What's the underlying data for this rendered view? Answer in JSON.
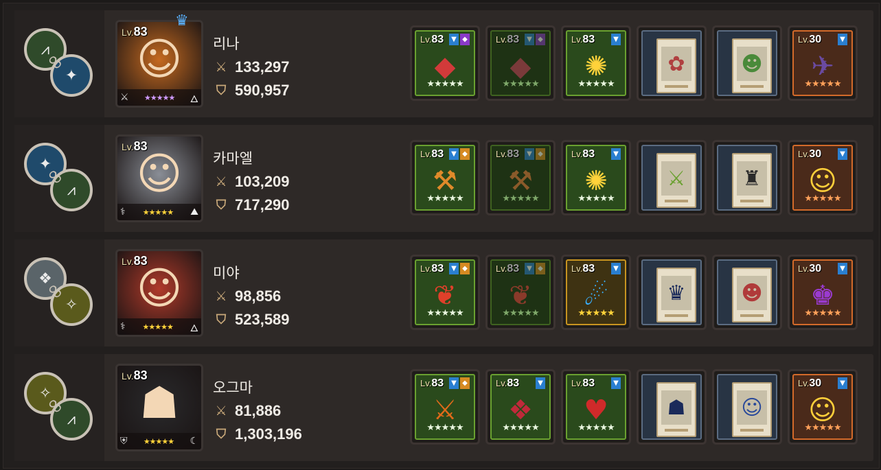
{
  "colors": {
    "star_white": "#eaf7e0",
    "star_gold": "#ffd33a",
    "star_purple": "#d09bff",
    "star_orange": "#ffa15a",
    "star_dim": "#7fa86a"
  },
  "rows": [
    {
      "emblems": [
        {
          "icon": "claw-icon",
          "glyph": "⩘",
          "color": "green"
        },
        {
          "icon": "wings-icon",
          "glyph": "✦",
          "color": "blue"
        }
      ],
      "hero": {
        "lv_prefix": "Lv.",
        "lv": "83",
        "name": "리나",
        "atk": "133,297",
        "def": "590,957",
        "crown": true,
        "portrait_color": "#c56a20",
        "portrait_glyph": "☺",
        "class_icon": "⚔",
        "element_icon": "🜂",
        "stars": "★★★★★",
        "star_color": "purple"
      },
      "items": [
        {
          "kind": "gear",
          "style": "green",
          "lv": "83",
          "tags": [
            "blue",
            "purple"
          ],
          "art": "◆",
          "art_color": "#d23a3a",
          "stars": "★★★★★",
          "star_color": "white"
        },
        {
          "kind": "gear",
          "style": "dim",
          "lv": "83",
          "tags": [
            "blue",
            "purple"
          ],
          "art": "◆",
          "art_color": "#7a3a3a",
          "stars": "★★★★★",
          "star_color": "dim"
        },
        {
          "kind": "gear",
          "style": "green",
          "lv": "83",
          "tags": [
            "blue"
          ],
          "art": "✺",
          "art_color": "#ffd23a",
          "stars": "★★★★★",
          "star_color": "white"
        },
        {
          "kind": "card",
          "art": "✿",
          "art_color": "#b04040"
        },
        {
          "kind": "card",
          "art": "☻",
          "art_color": "#4a8a3a"
        },
        {
          "kind": "gear",
          "style": "orange",
          "lv": "30",
          "tags": [
            "blue"
          ],
          "art": "✈",
          "art_color": "#6a4aa0",
          "stars": "★★★★★",
          "star_color": "orange"
        }
      ]
    },
    {
      "emblems": [
        {
          "icon": "wings-icon",
          "glyph": "✦",
          "color": "blue"
        },
        {
          "icon": "claw-icon",
          "glyph": "⩘",
          "color": "green"
        }
      ],
      "hero": {
        "lv_prefix": "Lv.",
        "lv": "83",
        "name": "카마엘",
        "atk": "103,209",
        "def": "717,290",
        "crown": false,
        "portrait_color": "#8a8e96",
        "portrait_glyph": "☺",
        "class_icon": "⚕",
        "element_icon": "⛰",
        "stars": "★★★★★",
        "star_color": "gold"
      },
      "items": [
        {
          "kind": "gear",
          "style": "green",
          "lv": "83",
          "tags": [
            "blue",
            "orange"
          ],
          "art": "⚒",
          "art_color": "#e08a2a",
          "stars": "★★★★★",
          "star_color": "white"
        },
        {
          "kind": "gear",
          "style": "dim",
          "lv": "83",
          "tags": [
            "blue",
            "orange"
          ],
          "art": "⚒",
          "art_color": "#8a5a2a",
          "stars": "★★★★★",
          "star_color": "dim"
        },
        {
          "kind": "gear",
          "style": "green",
          "lv": "83",
          "tags": [
            "blue"
          ],
          "art": "✺",
          "art_color": "#ffd23a",
          "stars": "★★★★★",
          "star_color": "white"
        },
        {
          "kind": "card",
          "art": "⚔",
          "art_color": "#6aa030"
        },
        {
          "kind": "card",
          "art": "♜",
          "art_color": "#2a2a2a"
        },
        {
          "kind": "gear",
          "style": "orange",
          "lv": "30",
          "tags": [
            "blue"
          ],
          "art": "☺",
          "art_color": "#ffcf3a",
          "stars": "★★★★★",
          "star_color": "orange"
        }
      ]
    },
    {
      "emblems": [
        {
          "icon": "shield-emblem-icon",
          "glyph": "❖",
          "color": "gray"
        },
        {
          "icon": "star-burst-icon",
          "glyph": "✧",
          "color": "olive"
        }
      ],
      "hero": {
        "lv_prefix": "Lv.",
        "lv": "83",
        "name": "미야",
        "atk": "98,856",
        "def": "523,589",
        "crown": false,
        "portrait_color": "#b03a2a",
        "portrait_glyph": "☺",
        "class_icon": "⚕",
        "element_icon": "🜂",
        "stars": "★★★★★",
        "star_color": "gold"
      },
      "items": [
        {
          "kind": "gear",
          "style": "green",
          "lv": "83",
          "tags": [
            "blue",
            "orange"
          ],
          "art": "❦",
          "art_color": "#e0402a",
          "stars": "★★★★★",
          "star_color": "white"
        },
        {
          "kind": "gear",
          "style": "dim",
          "lv": "83",
          "tags": [
            "blue",
            "orange"
          ],
          "art": "❦",
          "art_color": "#8a3a2a",
          "stars": "★★★★★",
          "star_color": "dim"
        },
        {
          "kind": "gear",
          "style": "gold",
          "lv": "83",
          "tags": [
            "blue"
          ],
          "art": "☄",
          "art_color": "#3ab0ff",
          "stars": "★★★★★",
          "star_color": "gold"
        },
        {
          "kind": "card",
          "art": "♛",
          "art_color": "#1a2a5a"
        },
        {
          "kind": "card",
          "art": "☻",
          "art_color": "#b03a3a"
        },
        {
          "kind": "gear",
          "style": "orange",
          "lv": "30",
          "tags": [
            "blue"
          ],
          "art": "♚",
          "art_color": "#9a3ad0",
          "stars": "★★★★★",
          "star_color": "orange"
        }
      ]
    },
    {
      "emblems": [
        {
          "icon": "star-burst-icon",
          "glyph": "✧",
          "color": "olive"
        },
        {
          "icon": "claw-icon",
          "glyph": "⩘",
          "color": "green"
        }
      ],
      "hero": {
        "lv_prefix": "Lv.",
        "lv": "83",
        "name": "오그마",
        "atk": "81,886",
        "def": "1,303,196",
        "crown": false,
        "portrait_color": "#2a2a2c",
        "portrait_glyph": "☗",
        "class_icon": "⛨",
        "element_icon": "☾",
        "stars": "★★★★★",
        "star_color": "gold"
      },
      "items": [
        {
          "kind": "gear",
          "style": "green",
          "lv": "83",
          "tags": [
            "blue",
            "orange"
          ],
          "art": "⚔",
          "art_color": "#e06a1a",
          "stars": "★★★★★",
          "star_color": "white"
        },
        {
          "kind": "gear",
          "style": "green",
          "lv": "83",
          "tags": [
            "blue"
          ],
          "art": "❖",
          "art_color": "#c02a3a",
          "stars": "★★★★★",
          "star_color": "white"
        },
        {
          "kind": "gear",
          "style": "green",
          "lv": "83",
          "tags": [
            "blue"
          ],
          "art": "♥",
          "art_color": "#d02a2a",
          "stars": "★★★★★",
          "star_color": "white"
        },
        {
          "kind": "card",
          "art": "☗",
          "art_color": "#1a2a5a"
        },
        {
          "kind": "card",
          "art": "☺",
          "art_color": "#2a4a9a"
        },
        {
          "kind": "gear",
          "style": "orange",
          "lv": "30",
          "tags": [
            "blue"
          ],
          "art": "☺",
          "art_color": "#ffcf3a",
          "stars": "★★★★★",
          "star_color": "orange"
        }
      ]
    }
  ]
}
